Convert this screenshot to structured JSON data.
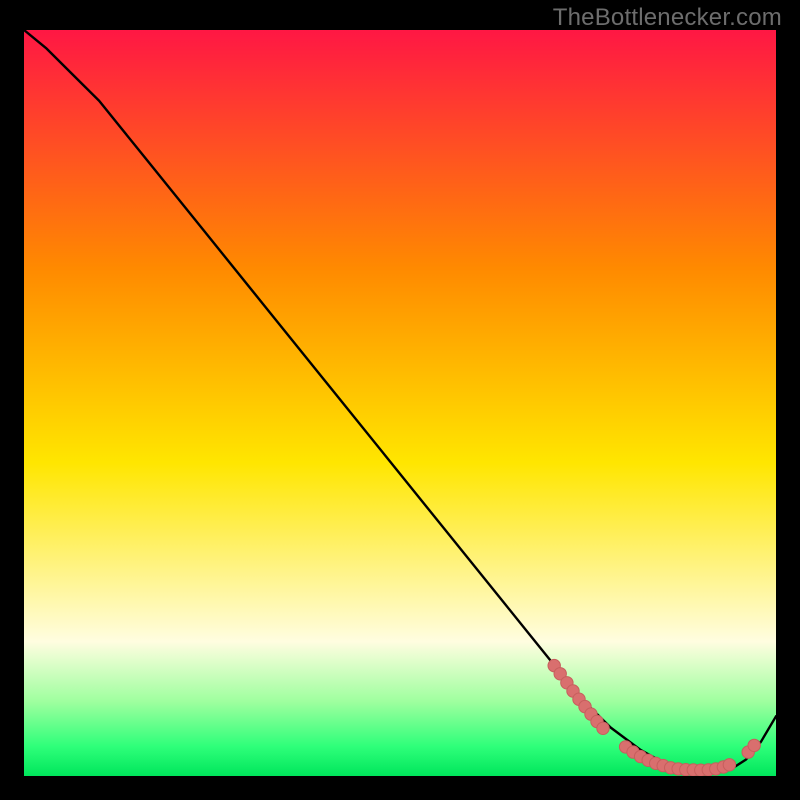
{
  "watermark": "TheBottlenecker.com",
  "colors": {
    "bg": "#000000",
    "watermark": "#6d6d6d",
    "line": "#000000",
    "dotFill": "#d96f6e",
    "dotStroke": "#c75e5d",
    "grad_top": "#ff1744",
    "grad_mid1": "#ff8a00",
    "grad_mid2": "#ffe600",
    "grad_lowYellow": "#fffde0",
    "grad_green1": "#9fff9f",
    "grad_green2": "#2fff7a",
    "grad_green3": "#00e65c"
  },
  "chart_data": {
    "type": "line",
    "title": "",
    "xlabel": "",
    "ylabel": "",
    "xlim": [
      0,
      100
    ],
    "ylim": [
      0,
      100
    ],
    "series": [
      {
        "name": "curve",
        "x": [
          0,
          3,
          6,
          10,
          16,
          24,
          32,
          40,
          48,
          56,
          64,
          70,
          74,
          78,
          82,
          85,
          88,
          90,
          92,
          94,
          96,
          98,
          100
        ],
        "y": [
          100,
          97.5,
          94.5,
          90.5,
          83,
          73,
          63,
          53,
          43,
          33,
          23,
          15.5,
          10.5,
          6.5,
          3.5,
          1.8,
          0.9,
          0.5,
          0.5,
          0.9,
          2.2,
          4.6,
          8
        ]
      }
    ],
    "dot_clusters": [
      {
        "name": "left-slope-cluster",
        "points": [
          [
            70.5,
            14.8
          ],
          [
            71.3,
            13.7
          ],
          [
            72.2,
            12.5
          ],
          [
            73.0,
            11.4
          ],
          [
            73.8,
            10.3
          ],
          [
            74.6,
            9.3
          ],
          [
            75.4,
            8.3
          ],
          [
            76.2,
            7.3
          ],
          [
            77.0,
            6.4
          ]
        ]
      },
      {
        "name": "valley-cluster",
        "points": [
          [
            80.0,
            3.9
          ],
          [
            81.0,
            3.2
          ],
          [
            82.0,
            2.6
          ],
          [
            83.0,
            2.1
          ],
          [
            84.0,
            1.7
          ],
          [
            85.0,
            1.4
          ],
          [
            86.0,
            1.1
          ],
          [
            87.0,
            0.95
          ],
          [
            88.0,
            0.85
          ],
          [
            89.0,
            0.8
          ],
          [
            90.0,
            0.78
          ],
          [
            91.0,
            0.82
          ],
          [
            92.0,
            0.95
          ],
          [
            93.0,
            1.2
          ],
          [
            93.8,
            1.5
          ]
        ]
      },
      {
        "name": "right-slope-cluster",
        "points": [
          [
            96.3,
            3.2
          ],
          [
            97.1,
            4.1
          ]
        ]
      }
    ]
  }
}
